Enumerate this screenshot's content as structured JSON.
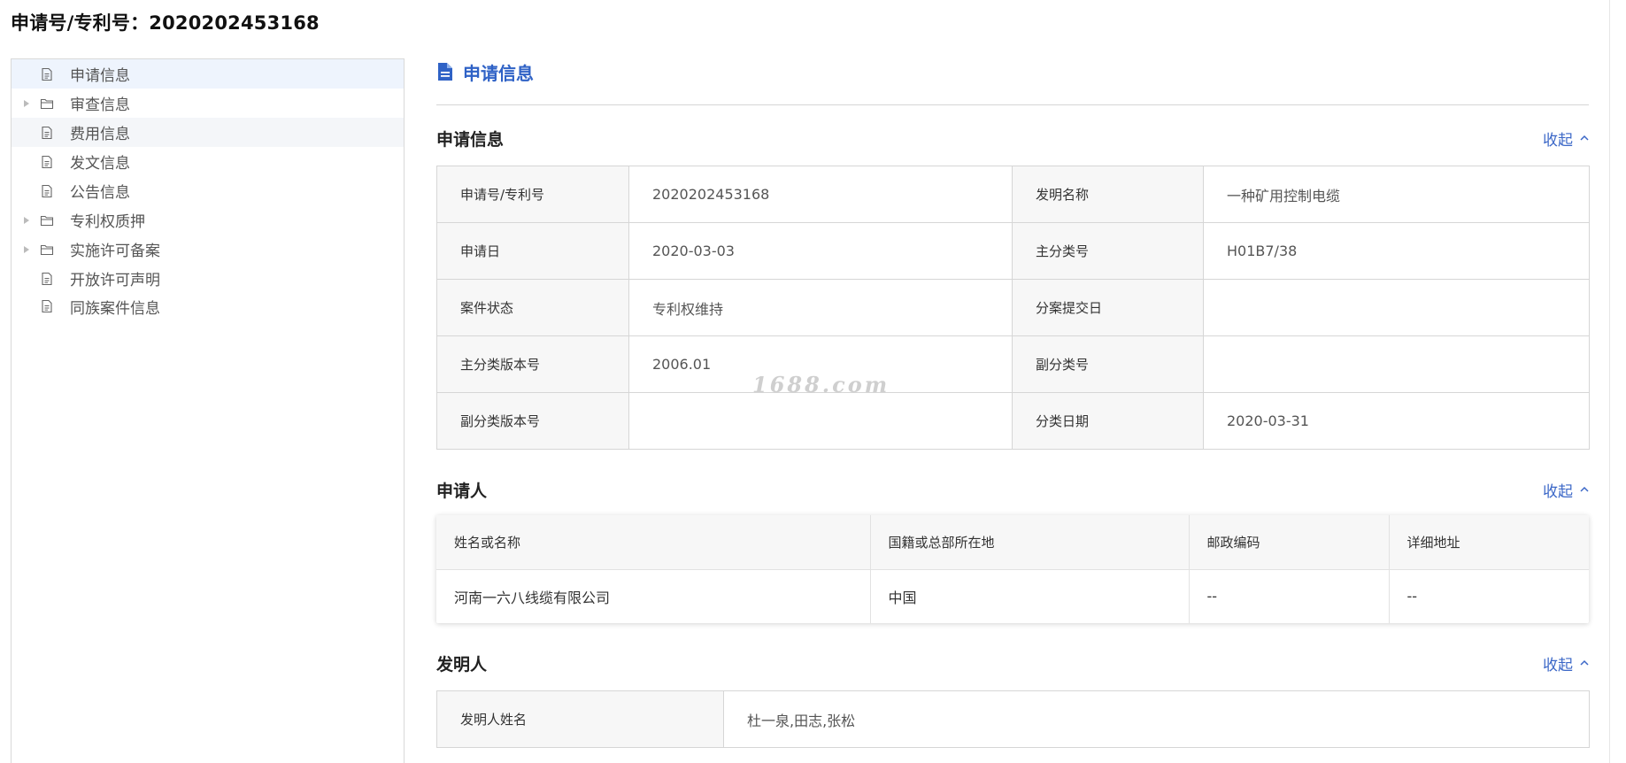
{
  "page_title": "申请号/专利号：2020202453168",
  "tree": [
    {
      "label": "申请信息",
      "icon": "file-icon",
      "expandable": false,
      "state": "selected"
    },
    {
      "label": "审查信息",
      "icon": "folder-icon",
      "expandable": true,
      "state": ""
    },
    {
      "label": "费用信息",
      "icon": "file-icon",
      "expandable": false,
      "state": "hover"
    },
    {
      "label": "发文信息",
      "icon": "file-icon",
      "expandable": false,
      "state": ""
    },
    {
      "label": "公告信息",
      "icon": "file-icon",
      "expandable": false,
      "state": ""
    },
    {
      "label": "专利权质押",
      "icon": "folder-icon",
      "expandable": true,
      "state": ""
    },
    {
      "label": "实施许可备案",
      "icon": "folder-icon",
      "expandable": true,
      "state": ""
    },
    {
      "label": "开放许可声明",
      "icon": "file-icon",
      "expandable": false,
      "state": ""
    },
    {
      "label": "同族案件信息",
      "icon": "file-icon",
      "expandable": false,
      "state": ""
    }
  ],
  "main": {
    "header": "申请信息",
    "collapse_label": "收起",
    "sections": {
      "application": {
        "title": "申请信息",
        "rows": [
          {
            "k1": "申请号/专利号",
            "v1": "2020202453168",
            "k2": "发明名称",
            "v2": "一种矿用控制电缆"
          },
          {
            "k1": "申请日",
            "v1": "2020-03-03",
            "k2": "主分类号",
            "v2": "H01B7/38"
          },
          {
            "k1": "案件状态",
            "v1": "专利权维持",
            "k2": "分案提交日",
            "v2": ""
          },
          {
            "k1": "主分类版本号",
            "v1": "2006.01",
            "k2": "副分类号",
            "v2": ""
          },
          {
            "k1": "副分类版本号",
            "v1": "",
            "k2": "分类日期",
            "v2": "2020-03-31"
          }
        ]
      },
      "applicant": {
        "title": "申请人",
        "headers": [
          "姓名或名称",
          "国籍或总部所在地",
          "邮政编码",
          "详细地址"
        ],
        "rows": [
          [
            "河南一六八线缆有限公司",
            "中国",
            "--",
            "--"
          ]
        ]
      },
      "inventor": {
        "title": "发明人",
        "label": "发明人姓名",
        "value": "杜一泉,田志,张松"
      }
    }
  },
  "watermark": "1688.com",
  "colors": {
    "accent": "#2f62c6",
    "link": "#3b67c7",
    "selected_bg": "#eef4fd"
  }
}
